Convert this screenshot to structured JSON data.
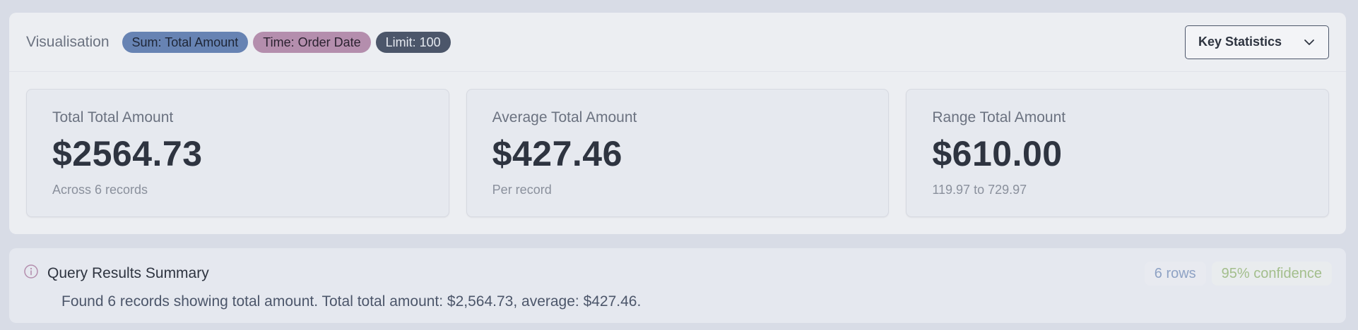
{
  "visualisation": {
    "title": "Visualisation",
    "pills": {
      "sum": "Sum: Total Amount",
      "time": "Time: Order Date",
      "limit": "Limit: 100"
    },
    "dropdown": {
      "selected": "Key Statistics",
      "icon": "chevron-down-icon"
    }
  },
  "cards": [
    {
      "label": "Total Total Amount",
      "value": "$2564.73",
      "sub": "Across 6 records"
    },
    {
      "label": "Average Total Amount",
      "value": "$427.46",
      "sub": "Per record"
    },
    {
      "label": "Range Total Amount",
      "value": "$610.00",
      "sub": "119.97 to 729.97"
    }
  ],
  "summary": {
    "icon": "info-icon",
    "title": "Query Results Summary",
    "rows_badge": "6 rows",
    "confidence_badge": "95% confidence",
    "text": "Found 6 records showing total amount. Total total amount: $2,564.73, average: $427.46."
  },
  "colors": {
    "pill_sum": "#6783b3",
    "pill_time": "#b48ead",
    "pill_limit": "#4c566a",
    "rows_badge": "#8ea2c4",
    "confidence_badge": "#a3be8c",
    "info_icon": "#b48ead"
  }
}
